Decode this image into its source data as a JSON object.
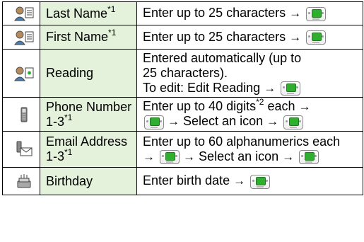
{
  "rows": [
    {
      "icon": "contact-name-icon",
      "label": "Last Name",
      "label_sup": "*1",
      "desc_parts": [
        "Enter up to 25 characters"
      ],
      "key_icon": "center-select-key-icon"
    },
    {
      "icon": "contact-name-icon",
      "label": "First Name",
      "label_sup": "*1",
      "desc_parts": [
        "Enter up to 25 characters"
      ],
      "key_icon": "center-select-key-icon"
    },
    {
      "icon": "contact-reading-icon",
      "label": "Reading",
      "desc_line1": "Entered automatically (up to",
      "desc_line2": "25 characters).",
      "desc_line3": "To edit: Edit Reading"
    },
    {
      "icon": "phone-icon",
      "label_line1": "Phone Number",
      "label_line2": "1-3",
      "label_sup": "*1",
      "desc_line1a": "Enter up to 40 digits",
      "desc_sup": "*2",
      "desc_line1b": " each",
      "desc_line2": "Select an icon"
    },
    {
      "icon": "email-icon",
      "label_line1": "Email Address",
      "label_line2": "1-3",
      "label_sup": "*1",
      "desc_line1": "Enter up to 60 alphanumerics each",
      "desc_line2": "Select an icon"
    },
    {
      "icon": "birthday-cake-icon",
      "label": "Birthday",
      "desc_line1": "Enter birth date"
    }
  ],
  "arrow": "→"
}
